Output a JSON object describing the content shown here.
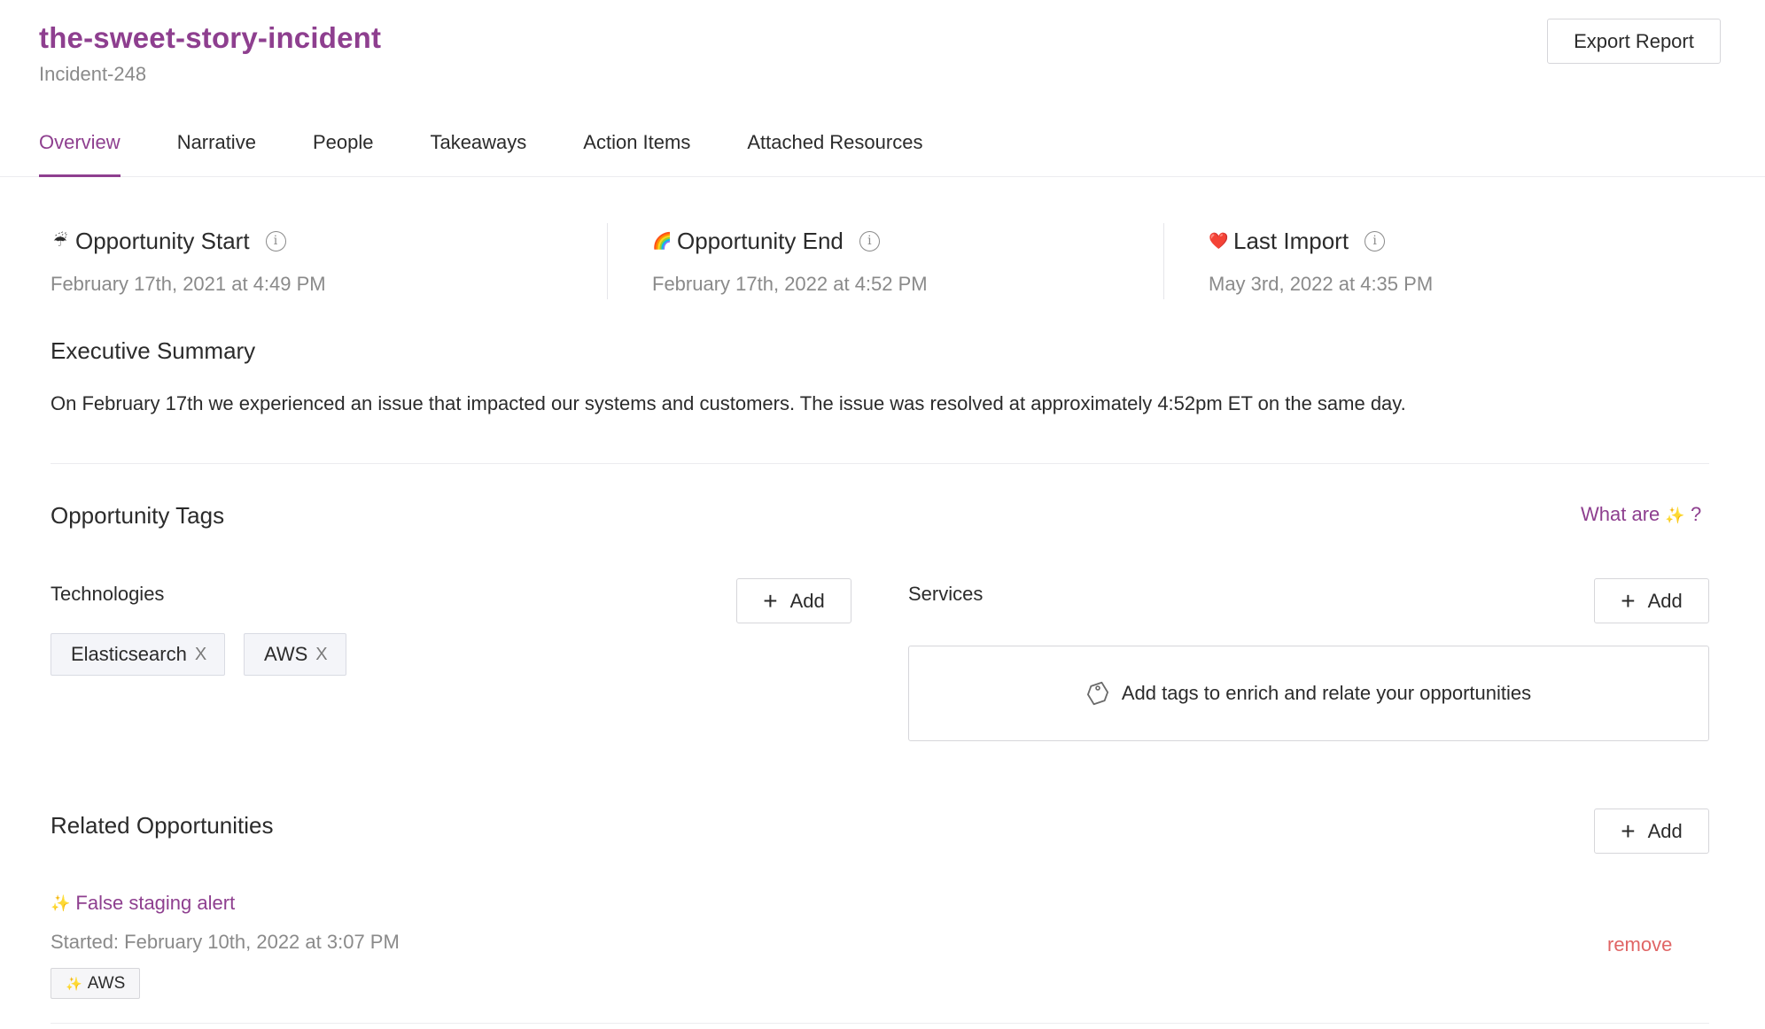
{
  "header": {
    "title": "the-sweet-story-incident",
    "subtitle": "Incident-248",
    "export_label": "Export Report"
  },
  "tabs": [
    {
      "label": "Overview",
      "active": true
    },
    {
      "label": "Narrative",
      "active": false
    },
    {
      "label": "People",
      "active": false
    },
    {
      "label": "Takeaways",
      "active": false
    },
    {
      "label": "Action Items",
      "active": false
    },
    {
      "label": "Attached Resources",
      "active": false
    }
  ],
  "stats": [
    {
      "emoji": "☔",
      "title": "Opportunity Start",
      "value": "February 17th, 2021 at 4:49 PM"
    },
    {
      "emoji": "🌈",
      "title": "Opportunity End",
      "value": "February 17th, 2022 at 4:52 PM"
    },
    {
      "emoji": "❤️",
      "title": "Last Import",
      "value": "May 3rd, 2022 at 4:35 PM"
    }
  ],
  "summary": {
    "title": "Executive Summary",
    "text": "On February 17th we experienced an issue that impacted our systems and customers. The issue was resolved at approximately 4:52pm ET on the same day."
  },
  "tags_section": {
    "title": "Opportunity Tags",
    "what_are_prefix": "What are",
    "what_are_emoji": "✨",
    "what_are_suffix": "?",
    "technologies": {
      "title": "Technologies",
      "add_label": "Add",
      "tags": [
        "Elasticsearch",
        "AWS"
      ]
    },
    "services": {
      "title": "Services",
      "add_label": "Add",
      "empty_text": "Add tags to enrich and relate your opportunities"
    }
  },
  "related": {
    "title": "Related Opportunities",
    "add_label": "Add",
    "items": [
      {
        "emoji": "✨",
        "name": "False staging alert",
        "started": "Started: February 10th, 2022 at 3:07 PM",
        "tag_emoji": "✨",
        "tag": "AWS",
        "remove_label": "remove"
      }
    ]
  },
  "colors": {
    "brand": "#8e3f8f",
    "muted": "#8a8a8a",
    "danger": "#e06565"
  },
  "icons": {
    "info": "info-icon",
    "plus": "plus-icon",
    "close": "close-icon",
    "tag": "tag-icon"
  }
}
